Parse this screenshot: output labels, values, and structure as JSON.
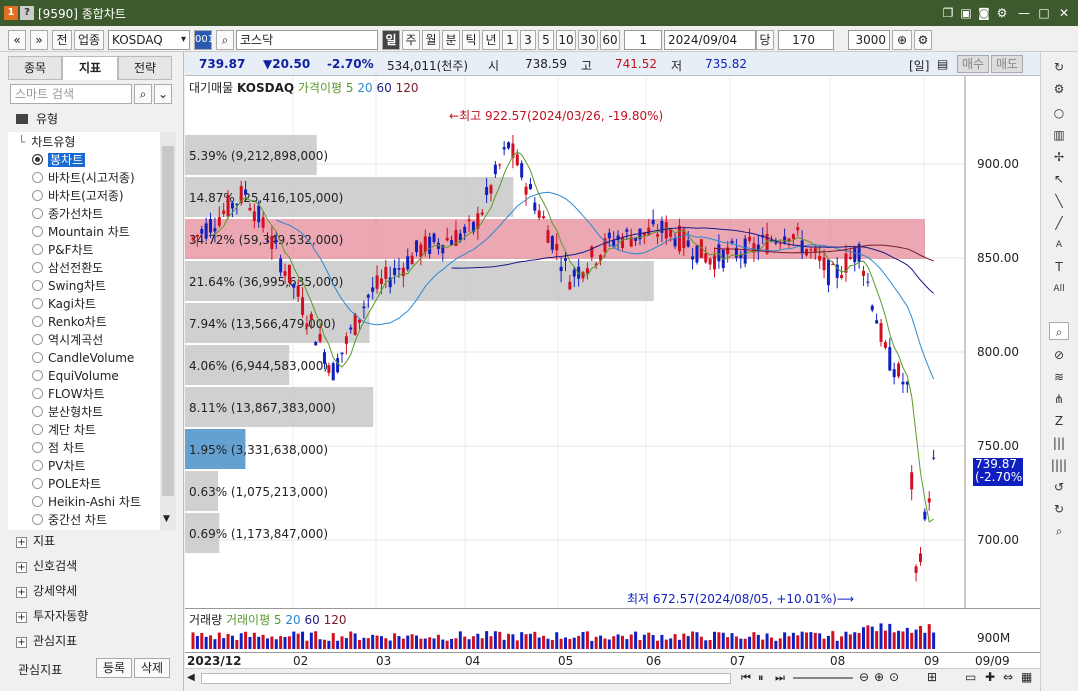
{
  "window": {
    "code": "[9590]",
    "title": "종합차트"
  },
  "toolbar": {
    "prev": "«",
    "next": "»",
    "jeon": "전",
    "sector": "업종",
    "market": "KOSDAQ",
    "code_btn": "001",
    "name": "코스닥",
    "periods": [
      "일",
      "주",
      "월",
      "분",
      "틱",
      "년"
    ],
    "intervals": [
      "1",
      "3",
      "5",
      "10",
      "30",
      "60"
    ],
    "count": "1",
    "date": "2024/09/04",
    "dang": "당",
    "view_count": "170",
    "total_count": "3000"
  },
  "left": {
    "tabs": [
      "종목",
      "지표",
      "전략"
    ],
    "search_placeholder": "스마트 검색",
    "group_label": "유형",
    "subgroup_label": "차트유형",
    "items": [
      "봉차트",
      "바차트(시고저종)",
      "바차트(고저종)",
      "종가선차트",
      "Mountain 차트",
      "P&F차트",
      "삼선전환도",
      "Swing차트",
      "Kagi차트",
      "Renko차트",
      "역시계곡선",
      "CandleVolume",
      "EquiVolume",
      "FLOW차트",
      "분산형차트",
      "계단 차트",
      "점 차트",
      "PV차트",
      "POLE차트",
      "Heikin-Ashi 차트",
      "중간선 차트"
    ],
    "sections": [
      "지표",
      "신호검색",
      "강세약세",
      "투자자동향",
      "관심지표"
    ],
    "footer_label": "관심지표",
    "footer_btn1": "등록",
    "footer_btn2": "삭제"
  },
  "info": {
    "price": "739.87",
    "change": "▼20.50",
    "rate": "-2.70%",
    "volume": "534,011(천주)",
    "open_label": "시",
    "open": "738.59",
    "high_label": "고",
    "high": "741.52",
    "low_label": "저",
    "low": "735.82",
    "period_label": "[일]",
    "buy": "매수",
    "sell": "매도"
  },
  "legend": {
    "prefix": "대기매물",
    "market": "KOSDAQ",
    "ma_label": "가격이평 5",
    "ma20": "20",
    "ma60": "60",
    "ma120": "120"
  },
  "vol_legend": {
    "label": "거래량",
    "ma_label": "거래이평 5",
    "ma20": "20",
    "ma60": "60",
    "ma120": "120"
  },
  "annotations": {
    "high": "최고 922.57(2024/03/26, -19.80%)",
    "low": "최저 672.57(2024/08/05, +10.01%)",
    "last_price": "739.87",
    "last_rate": "(-2.70%)"
  },
  "profile": [
    {
      "label": "5.39% (9,212,898,000)",
      "pct": 5.39
    },
    {
      "label": "14.87% (25,416,105,000)",
      "pct": 14.87
    },
    {
      "label": "34.72% (59,349,532,000)",
      "pct": 34.72,
      "highlight": true
    },
    {
      "label": "21.64% (36,995,635,000)",
      "pct": 21.64
    },
    {
      "label": "7.94% (13,566,479,000)",
      "pct": 7.94
    },
    {
      "label": "4.06% (6,944,583,000)",
      "pct": 4.06
    },
    {
      "label": "8.11% (13,867,383,000)",
      "pct": 8.11
    },
    {
      "label": "1.95% (3,331,638,000)",
      "pct": 1.95,
      "current": true
    },
    {
      "label": "0.63% (1,075,213,000)",
      "pct": 0.63
    },
    {
      "label": "0.69% (1,173,847,000)",
      "pct": 0.69
    }
  ],
  "y_ticks": [
    "900.00",
    "850.00",
    "800.00",
    "750.00",
    "700.00"
  ],
  "vol_tick": "900M",
  "x_ticks": [
    "2023/12",
    "02",
    "03",
    "04",
    "05",
    "06",
    "07",
    "08",
    "09"
  ],
  "x_end": "09/09",
  "colors": {
    "up": "#d01020",
    "down": "#1020c0",
    "ma5": "#5a9a2a",
    "ma20": "#2a8ad0",
    "ma60": "#1a1a8a",
    "ma120": "#7a1a2a",
    "highlight": "#e07080"
  }
}
